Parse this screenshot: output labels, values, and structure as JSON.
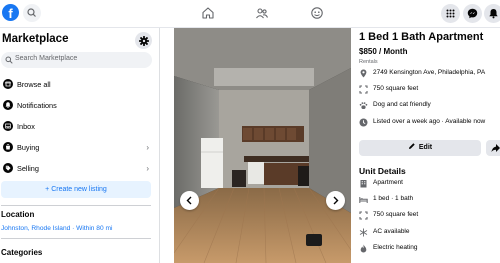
{
  "topbar": {
    "logo_letter": "f",
    "icons": [
      "home-icon",
      "groups-icon",
      "gaming-icon",
      "menu-grid-icon",
      "messenger-icon",
      "notifications-icon"
    ]
  },
  "sidebar": {
    "title": "Marketplace",
    "search_placeholder": "Search Marketplace",
    "items": [
      {
        "label": "Browse all",
        "icon": "storefront-icon"
      },
      {
        "label": "Notifications",
        "icon": "bell-icon"
      },
      {
        "label": "Inbox",
        "icon": "inbox-icon"
      },
      {
        "label": "Buying",
        "icon": "bag-icon"
      },
      {
        "label": "Selling",
        "icon": "tag-icon"
      }
    ],
    "create_label": "+ Create new listing",
    "location_title": "Location",
    "location_value": "Johnston, Rhode Island · Within 80 mi",
    "categories_title": "Categories"
  },
  "listing": {
    "title": "1 Bed 1 Bath Apartment",
    "price": "$850 / Month",
    "category": "Rentals",
    "address": "2749 Kensington Ave, Philadelphia, PA",
    "size": "750 square feet",
    "pets": "Dog and cat friendly",
    "listed": "Listed over a week ago · Available now",
    "edit_label": "Edit",
    "unit_details_title": "Unit Details",
    "unit_details": [
      {
        "label": "Apartment",
        "icon": "building-icon"
      },
      {
        "label": "1 bed · 1 bath",
        "icon": "bed-icon"
      },
      {
        "label": "750 square feet",
        "icon": "area-icon"
      },
      {
        "label": "AC available",
        "icon": "snowflake-icon"
      },
      {
        "label": "Electric heating",
        "icon": "heating-icon"
      }
    ]
  },
  "colors": {
    "brand": "#1877f2",
    "soft_bg": "#f0f2f5",
    "button_bg": "#e4e6eb",
    "muted_text": "#65676b"
  }
}
